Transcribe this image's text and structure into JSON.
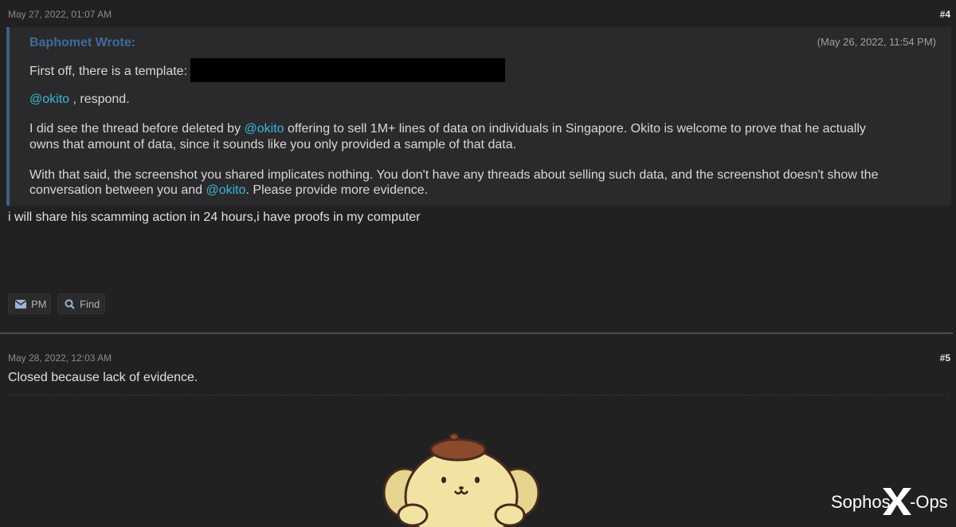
{
  "post4": {
    "timestamp": "May 27, 2022, 01:07 AM",
    "number": "#4",
    "quote": {
      "author": "Baphomet Wrote:",
      "date": "(May 26, 2022, 11:54 PM)",
      "line1": "First off, there is a template:",
      "line2_mention": "@okito",
      "line2_rest": " , respond.",
      "para1_a": "I did see the thread before deleted by ",
      "para1_mention": "@okito",
      "para1_b": " offering to sell 1M+ lines of data on individuals in Singapore. Okito is welcome to prove that he actually",
      "para1_c": "owns that amount of data, since it sounds like you only provided a sample of that data.",
      "para2_a": "With that said, the screenshot you shared implicates nothing. You don't have any threads about selling such data, and the screenshot doesn't show the",
      "para2_b": "conversation between you and ",
      "para2_mention": "@okito",
      "para2_c": ". Please provide more evidence."
    },
    "reply": "i will share his scamming action in 24 hours,i have proofs in my computer",
    "buttons": {
      "pm": "PM",
      "find": "Find"
    }
  },
  "post5": {
    "timestamp": "May 28, 2022, 12:03 AM",
    "number": "#5",
    "text": "Closed because lack of evidence."
  },
  "watermark": {
    "text_left": "Sophos",
    "text_right": "Ops"
  },
  "colors": {
    "background": "#212121",
    "quote_bg": "#2a2a2c",
    "quote_border": "#3f5f86",
    "mention": "#3bb6d8",
    "author": "#3f6a9b"
  }
}
